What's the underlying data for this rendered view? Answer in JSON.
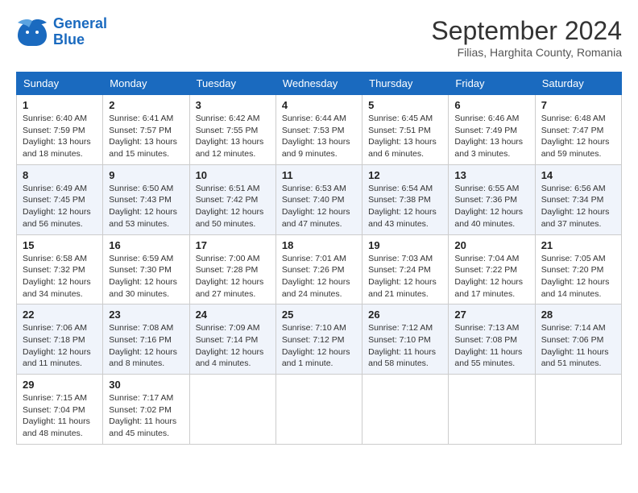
{
  "header": {
    "logo_line1": "General",
    "logo_line2": "Blue",
    "month_title": "September 2024",
    "subtitle": "Filias, Harghita County, Romania"
  },
  "days_of_week": [
    "Sunday",
    "Monday",
    "Tuesday",
    "Wednesday",
    "Thursday",
    "Friday",
    "Saturday"
  ],
  "weeks": [
    [
      {
        "day": "1",
        "info": "Sunrise: 6:40 AM\nSunset: 7:59 PM\nDaylight: 13 hours and 18 minutes."
      },
      {
        "day": "2",
        "info": "Sunrise: 6:41 AM\nSunset: 7:57 PM\nDaylight: 13 hours and 15 minutes."
      },
      {
        "day": "3",
        "info": "Sunrise: 6:42 AM\nSunset: 7:55 PM\nDaylight: 13 hours and 12 minutes."
      },
      {
        "day": "4",
        "info": "Sunrise: 6:44 AM\nSunset: 7:53 PM\nDaylight: 13 hours and 9 minutes."
      },
      {
        "day": "5",
        "info": "Sunrise: 6:45 AM\nSunset: 7:51 PM\nDaylight: 13 hours and 6 minutes."
      },
      {
        "day": "6",
        "info": "Sunrise: 6:46 AM\nSunset: 7:49 PM\nDaylight: 13 hours and 3 minutes."
      },
      {
        "day": "7",
        "info": "Sunrise: 6:48 AM\nSunset: 7:47 PM\nDaylight: 12 hours and 59 minutes."
      }
    ],
    [
      {
        "day": "8",
        "info": "Sunrise: 6:49 AM\nSunset: 7:45 PM\nDaylight: 12 hours and 56 minutes."
      },
      {
        "day": "9",
        "info": "Sunrise: 6:50 AM\nSunset: 7:43 PM\nDaylight: 12 hours and 53 minutes."
      },
      {
        "day": "10",
        "info": "Sunrise: 6:51 AM\nSunset: 7:42 PM\nDaylight: 12 hours and 50 minutes."
      },
      {
        "day": "11",
        "info": "Sunrise: 6:53 AM\nSunset: 7:40 PM\nDaylight: 12 hours and 47 minutes."
      },
      {
        "day": "12",
        "info": "Sunrise: 6:54 AM\nSunset: 7:38 PM\nDaylight: 12 hours and 43 minutes."
      },
      {
        "day": "13",
        "info": "Sunrise: 6:55 AM\nSunset: 7:36 PM\nDaylight: 12 hours and 40 minutes."
      },
      {
        "day": "14",
        "info": "Sunrise: 6:56 AM\nSunset: 7:34 PM\nDaylight: 12 hours and 37 minutes."
      }
    ],
    [
      {
        "day": "15",
        "info": "Sunrise: 6:58 AM\nSunset: 7:32 PM\nDaylight: 12 hours and 34 minutes."
      },
      {
        "day": "16",
        "info": "Sunrise: 6:59 AM\nSunset: 7:30 PM\nDaylight: 12 hours and 30 minutes."
      },
      {
        "day": "17",
        "info": "Sunrise: 7:00 AM\nSunset: 7:28 PM\nDaylight: 12 hours and 27 minutes."
      },
      {
        "day": "18",
        "info": "Sunrise: 7:01 AM\nSunset: 7:26 PM\nDaylight: 12 hours and 24 minutes."
      },
      {
        "day": "19",
        "info": "Sunrise: 7:03 AM\nSunset: 7:24 PM\nDaylight: 12 hours and 21 minutes."
      },
      {
        "day": "20",
        "info": "Sunrise: 7:04 AM\nSunset: 7:22 PM\nDaylight: 12 hours and 17 minutes."
      },
      {
        "day": "21",
        "info": "Sunrise: 7:05 AM\nSunset: 7:20 PM\nDaylight: 12 hours and 14 minutes."
      }
    ],
    [
      {
        "day": "22",
        "info": "Sunrise: 7:06 AM\nSunset: 7:18 PM\nDaylight: 12 hours and 11 minutes."
      },
      {
        "day": "23",
        "info": "Sunrise: 7:08 AM\nSunset: 7:16 PM\nDaylight: 12 hours and 8 minutes."
      },
      {
        "day": "24",
        "info": "Sunrise: 7:09 AM\nSunset: 7:14 PM\nDaylight: 12 hours and 4 minutes."
      },
      {
        "day": "25",
        "info": "Sunrise: 7:10 AM\nSunset: 7:12 PM\nDaylight: 12 hours and 1 minute."
      },
      {
        "day": "26",
        "info": "Sunrise: 7:12 AM\nSunset: 7:10 PM\nDaylight: 11 hours and 58 minutes."
      },
      {
        "day": "27",
        "info": "Sunrise: 7:13 AM\nSunset: 7:08 PM\nDaylight: 11 hours and 55 minutes."
      },
      {
        "day": "28",
        "info": "Sunrise: 7:14 AM\nSunset: 7:06 PM\nDaylight: 11 hours and 51 minutes."
      }
    ],
    [
      {
        "day": "29",
        "info": "Sunrise: 7:15 AM\nSunset: 7:04 PM\nDaylight: 11 hours and 48 minutes."
      },
      {
        "day": "30",
        "info": "Sunrise: 7:17 AM\nSunset: 7:02 PM\nDaylight: 11 hours and 45 minutes."
      },
      null,
      null,
      null,
      null,
      null
    ]
  ]
}
